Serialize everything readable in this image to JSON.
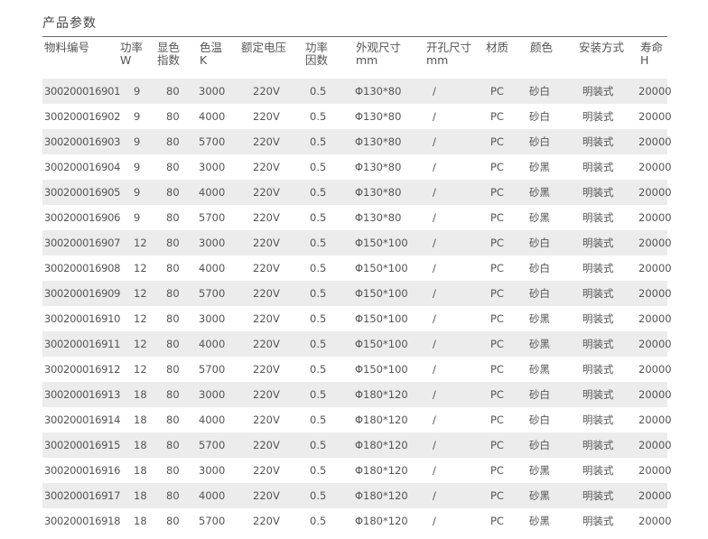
{
  "title": "产品参数",
  "columns": [
    {
      "line1": "物料编号",
      "line2": ""
    },
    {
      "line1": "功率",
      "line2": "W"
    },
    {
      "line1": "显色",
      "line2": "指数"
    },
    {
      "line1": "色温",
      "line2": "K"
    },
    {
      "line1": "额定电压",
      "line2": ""
    },
    {
      "line1": "功率",
      "line2": "因数"
    },
    {
      "line1": "外观尺寸",
      "line2": "mm"
    },
    {
      "line1": "开孔尺寸",
      "line2": "mm"
    },
    {
      "line1": "材质",
      "line2": ""
    },
    {
      "line1": "颜色",
      "line2": ""
    },
    {
      "line1": "安装方式",
      "line2": ""
    },
    {
      "line1": "寿命",
      "line2": "H"
    }
  ],
  "rows": [
    [
      "300200016901",
      "9",
      "80",
      "3000",
      "220V",
      "0.5",
      "Φ130*80",
      "/",
      "PC",
      "砂白",
      "明装式",
      "20000"
    ],
    [
      "300200016902",
      "9",
      "80",
      "4000",
      "220V",
      "0.5",
      "Φ130*80",
      "/",
      "PC",
      "砂白",
      "明装式",
      "20000"
    ],
    [
      "300200016903",
      "9",
      "80",
      "5700",
      "220V",
      "0.5",
      "Φ130*80",
      "/",
      "PC",
      "砂白",
      "明装式",
      "20000"
    ],
    [
      "300200016904",
      "9",
      "80",
      "3000",
      "220V",
      "0.5",
      "Φ130*80",
      "/",
      "PC",
      "砂黑",
      "明装式",
      "20000"
    ],
    [
      "300200016905",
      "9",
      "80",
      "4000",
      "220V",
      "0.5",
      "Φ130*80",
      "/",
      "PC",
      "砂黑",
      "明装式",
      "20000"
    ],
    [
      "300200016906",
      "9",
      "80",
      "5700",
      "220V",
      "0.5",
      "Φ130*80",
      "/",
      "PC",
      "砂黑",
      "明装式",
      "20000"
    ],
    [
      "300200016907",
      "12",
      "80",
      "3000",
      "220V",
      "0.5",
      "Φ150*100",
      "/",
      "PC",
      "砂白",
      "明装式",
      "20000"
    ],
    [
      "300200016908",
      "12",
      "80",
      "4000",
      "220V",
      "0.5",
      "Φ150*100",
      "/",
      "PC",
      "砂白",
      "明装式",
      "20000"
    ],
    [
      "300200016909",
      "12",
      "80",
      "5700",
      "220V",
      "0.5",
      "Φ150*100",
      "/",
      "PC",
      "砂白",
      "明装式",
      "20000"
    ],
    [
      "300200016910",
      "12",
      "80",
      "3000",
      "220V",
      "0.5",
      "Φ150*100",
      "/",
      "PC",
      "砂黑",
      "明装式",
      "20000"
    ],
    [
      "300200016911",
      "12",
      "80",
      "4000",
      "220V",
      "0.5",
      "Φ150*100",
      "/",
      "PC",
      "砂黑",
      "明装式",
      "20000"
    ],
    [
      "300200016912",
      "12",
      "80",
      "5700",
      "220V",
      "0.5",
      "Φ150*100",
      "/",
      "PC",
      "砂黑",
      "明装式",
      "20000"
    ],
    [
      "300200016913",
      "18",
      "80",
      "3000",
      "220V",
      "0.5",
      "Φ180*120",
      "/",
      "PC",
      "砂白",
      "明装式",
      "20000"
    ],
    [
      "300200016914",
      "18",
      "80",
      "4000",
      "220V",
      "0.5",
      "Φ180*120",
      "/",
      "PC",
      "砂白",
      "明装式",
      "20000"
    ],
    [
      "300200016915",
      "18",
      "80",
      "5700",
      "220V",
      "0.5",
      "Φ180*120",
      "/",
      "PC",
      "砂白",
      "明装式",
      "20000"
    ],
    [
      "300200016916",
      "18",
      "80",
      "3000",
      "220V",
      "0.5",
      "Φ180*120",
      "/",
      "PC",
      "砂黑",
      "明装式",
      "20000"
    ],
    [
      "300200016917",
      "18",
      "80",
      "4000",
      "220V",
      "0.5",
      "Φ180*120",
      "/",
      "PC",
      "砂黑",
      "明装式",
      "20000"
    ],
    [
      "300200016918",
      "18",
      "80",
      "5700",
      "220V",
      "0.5",
      "Φ180*120",
      "/",
      "PC",
      "砂黑",
      "明装式",
      "20000"
    ]
  ]
}
